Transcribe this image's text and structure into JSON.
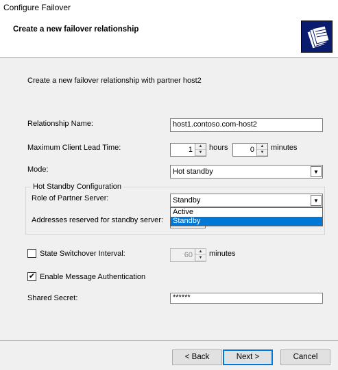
{
  "window": {
    "title": "Configure Failover"
  },
  "header": {
    "title": "Create a new failover relationship",
    "logo_icon": "folders-icon"
  },
  "intro": {
    "text": "Create a new failover relationship with partner host2"
  },
  "relationship_name": {
    "label": "Relationship Name:",
    "value": "host1.contoso.com-host2"
  },
  "mclt": {
    "label": "Maximum Client Lead Time:",
    "hours_value": "1",
    "hours_unit": "hours",
    "minutes_value": "0",
    "minutes_unit": "minutes"
  },
  "mode": {
    "label": "Mode:",
    "value": "Hot standby"
  },
  "hot_standby": {
    "group_title": "Hot Standby Configuration",
    "role_label": "Role of Partner Server:",
    "role_value": "Standby",
    "role_options": [
      "Active",
      "Standby"
    ],
    "reserved_label": "Addresses reserved for standby server:"
  },
  "switchover": {
    "label": "State Switchover Interval:",
    "checked": false,
    "value": "60",
    "unit": "minutes"
  },
  "message_auth": {
    "label": "Enable Message Authentication",
    "checked": true
  },
  "shared_secret": {
    "label": "Shared Secret:",
    "value": "******"
  },
  "buttons": {
    "back": "< Back",
    "next": "Next >",
    "cancel": "Cancel"
  }
}
